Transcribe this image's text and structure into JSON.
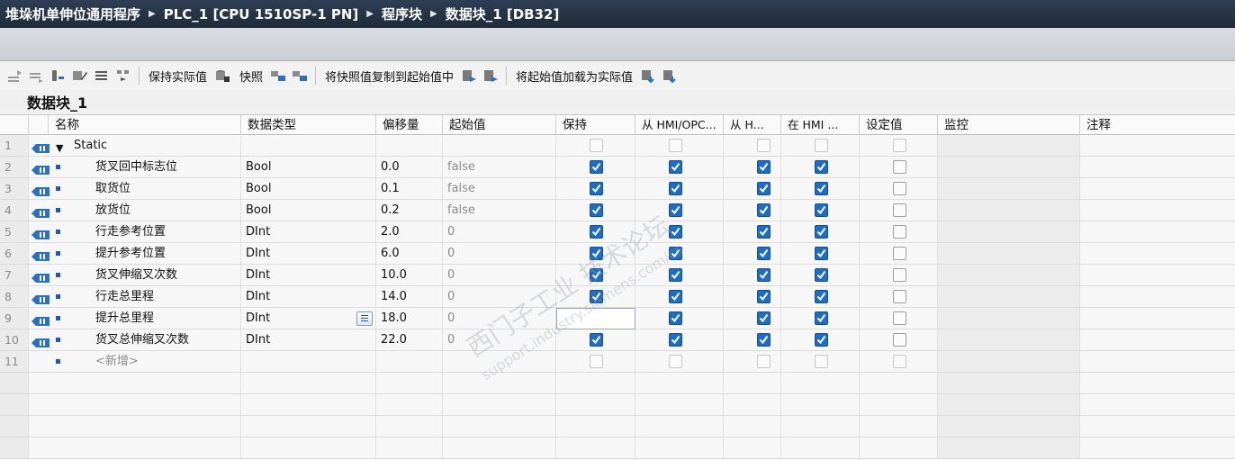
{
  "breadcrumb": [
    "堆垛机单伸位通用程序",
    "PLC_1 [CPU 1510SP-1 PN]",
    "程序块",
    "数据块_1 [DB32]"
  ],
  "toolbar": {
    "keep_actual": "保持实际值",
    "snapshot": "快照",
    "copy_snapshot": "将快照值复制到起始值中",
    "load_start": "将起始值加载为实际值"
  },
  "db_title": "数据块_1",
  "columns": {
    "name": "名称",
    "datatype": "数据类型",
    "offset": "偏移量",
    "start_value": "起始值",
    "retain": "保持",
    "hmi_opc": "从 HMI/OPC...",
    "hmi_h": "从 H...",
    "hmi_in": "在 HMI ...",
    "setpoint": "设定值",
    "monitor": "监控",
    "comment": "注释"
  },
  "rows": [
    {
      "num": "1",
      "name": "Static",
      "type": "",
      "offset": "",
      "start": ""
    },
    {
      "num": "2",
      "name": "货叉回中标志位",
      "type": "Bool",
      "offset": "0.0",
      "start": "false"
    },
    {
      "num": "3",
      "name": "取货位",
      "type": "Bool",
      "offset": "0.1",
      "start": "false"
    },
    {
      "num": "4",
      "name": "放货位",
      "type": "Bool",
      "offset": "0.2",
      "start": "false"
    },
    {
      "num": "5",
      "name": "行走参考位置",
      "type": "DInt",
      "offset": "2.0",
      "start": "0"
    },
    {
      "num": "6",
      "name": "提升参考位置",
      "type": "DInt",
      "offset": "6.0",
      "start": "0"
    },
    {
      "num": "7",
      "name": "货叉伸缩叉次数",
      "type": "DInt",
      "offset": "10.0",
      "start": "0"
    },
    {
      "num": "8",
      "name": "行走总里程",
      "type": "DInt",
      "offset": "14.0",
      "start": "0"
    },
    {
      "num": "9",
      "name": "提升总里程",
      "type": "DInt",
      "offset": "18.0",
      "start": "0"
    },
    {
      "num": "10",
      "name": "货叉总伸缩叉次数",
      "type": "DInt",
      "offset": "22.0",
      "start": "0"
    },
    {
      "num": "11",
      "name": "<新增>",
      "type": "",
      "offset": "",
      "start": ""
    }
  ],
  "watermark": {
    "line1": "西门子工业 技术论坛",
    "line2": "support.industry.siemens.com/cs"
  },
  "colors": {
    "title_bg": "#243246",
    "check_blue": "#1d6cc5"
  }
}
